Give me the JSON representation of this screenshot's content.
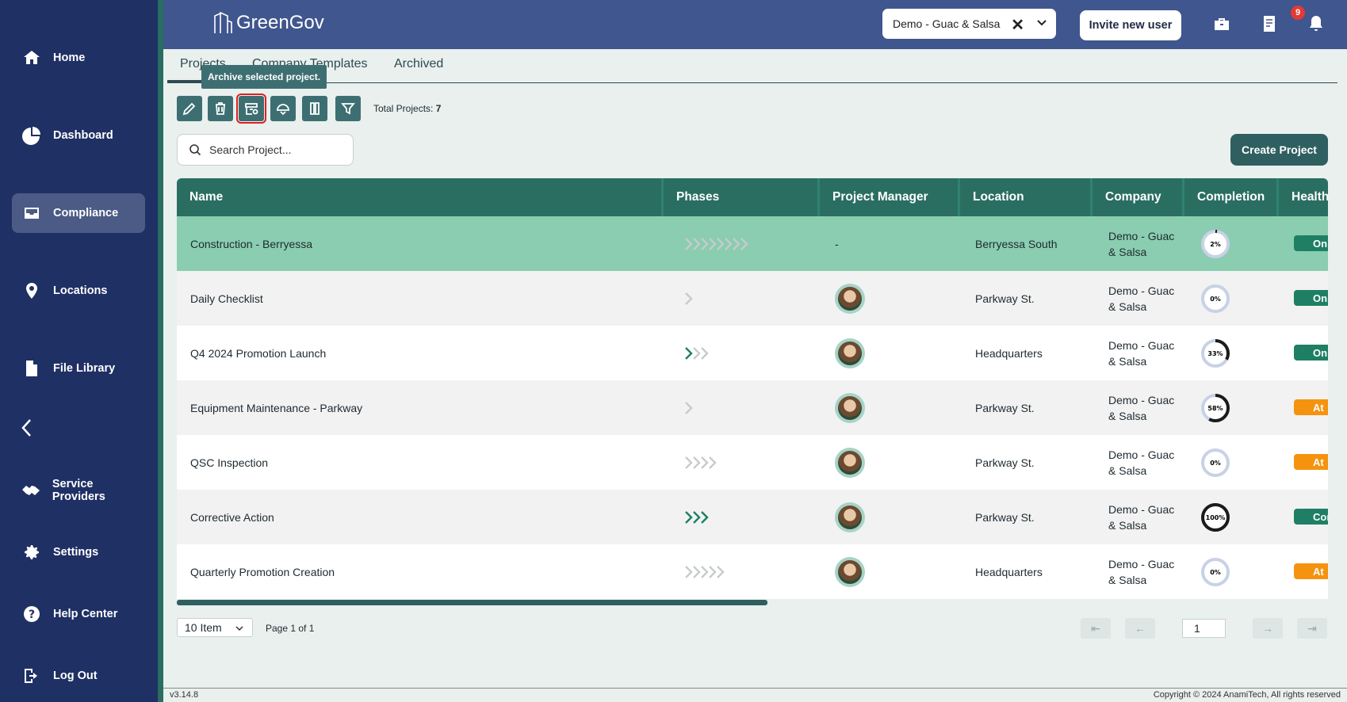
{
  "app": {
    "title": "GreenGov"
  },
  "sidebar": {
    "items": [
      {
        "label": "Home",
        "icon": "home-icon"
      },
      {
        "label": "Dashboard",
        "icon": "pie-chart-icon"
      },
      {
        "label": "Compliance",
        "icon": "inbox-icon",
        "active": true
      },
      {
        "label": "Locations",
        "icon": "map-pin-icon"
      },
      {
        "label": "File Library",
        "icon": "file-icon"
      },
      {
        "label": "Service Providers",
        "icon": "handshake-icon"
      },
      {
        "label": "Settings",
        "icon": "gear-icon"
      },
      {
        "label": "Help Center",
        "icon": "help-icon"
      },
      {
        "label": "Log Out",
        "icon": "logout-icon"
      }
    ]
  },
  "header": {
    "company_selected": "Demo - Guac & Salsa",
    "invite_label": "Invite new user",
    "notification_count": "9"
  },
  "tabs": [
    {
      "label": "Projects",
      "active": true
    },
    {
      "label": "Company Templates"
    },
    {
      "label": "Archived"
    }
  ],
  "toolbar": {
    "tooltip": "Archive selected project.",
    "total_label": "Total Projects:",
    "total_count": "7"
  },
  "search": {
    "placeholder": "Search Project..."
  },
  "create_label": "Create Project",
  "table": {
    "columns": [
      "Name",
      "Phases",
      "Project Manager",
      "Location",
      "Company",
      "Completion",
      "Health"
    ],
    "rows": [
      {
        "name": "Construction - Berryessa",
        "phases_done": 0,
        "phases_total": 8,
        "manager": "-",
        "location": "Berryessa South",
        "company_l1": "Demo - Guac",
        "company_l2": "& Salsa",
        "completion": "2%",
        "completion_value": 2,
        "health": "On",
        "health_color": "#1e7f64"
      },
      {
        "name": "Daily Checklist",
        "phases_done": 0,
        "phases_total": 1,
        "manager": "avatar",
        "location": "Parkway St.",
        "company_l1": "Demo - Guac",
        "company_l2": "& Salsa",
        "completion": "0%",
        "completion_value": 0,
        "health": "On",
        "health_color": "#1e7f64"
      },
      {
        "name": "Q4 2024 Promotion Launch",
        "phases_done": 1,
        "phases_total": 3,
        "manager": "avatar",
        "location": "Headquarters",
        "company_l1": "Demo - Guac",
        "company_l2": "& Salsa",
        "completion": "33%",
        "completion_value": 33,
        "health": "On",
        "health_color": "#1e7f64"
      },
      {
        "name": "Equipment Maintenance - Parkway",
        "phases_done": 0,
        "phases_total": 1,
        "manager": "avatar",
        "location": "Parkway St.",
        "company_l1": "Demo - Guac",
        "company_l2": "& Salsa",
        "completion": "58%",
        "completion_value": 58,
        "health": "At",
        "health_color": "#f5930f"
      },
      {
        "name": "QSC Inspection",
        "phases_done": 0,
        "phases_total": 4,
        "manager": "avatar",
        "location": "Parkway St.",
        "company_l1": "Demo - Guac",
        "company_l2": "& Salsa",
        "completion": "0%",
        "completion_value": 0,
        "health": "At",
        "health_color": "#f5930f"
      },
      {
        "name": "Corrective Action",
        "phases_done": 3,
        "phases_total": 3,
        "manager": "avatar",
        "location": "Parkway St.",
        "company_l1": "Demo - Guac",
        "company_l2": "& Salsa",
        "completion": "100%",
        "completion_value": 100,
        "health": "Cor",
        "health_color": "#1e7f64"
      },
      {
        "name": "Quarterly Promotion Creation",
        "phases_done": 0,
        "phases_total": 5,
        "manager": "avatar",
        "location": "Headquarters",
        "company_l1": "Demo - Guac",
        "company_l2": "& Salsa",
        "completion": "0%",
        "completion_value": 0,
        "health": "At",
        "health_color": "#f5930f"
      }
    ]
  },
  "pagination": {
    "page_size": "10 Item",
    "page_info": "Page 1 of 1",
    "current_page": "1"
  },
  "footer": {
    "version": "v3.14.8",
    "copyright": "Copyright © 2024 AnamiTech, All rights reserved"
  }
}
